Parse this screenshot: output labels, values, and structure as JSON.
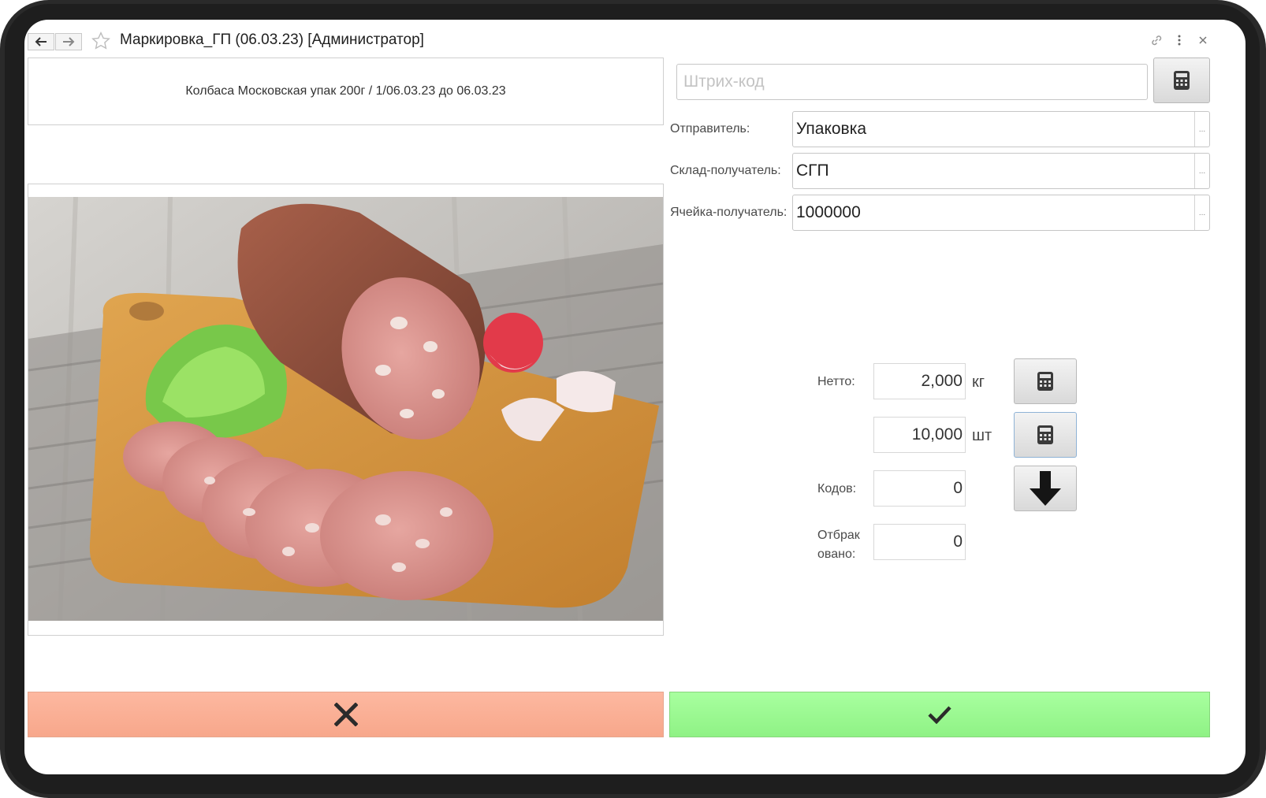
{
  "window": {
    "title": "Маркировка_ГП (06.03.23) [Администратор]"
  },
  "product": {
    "description": "Колбаса Московская упак 200г / 1/06.03.23 до 06.03.23"
  },
  "barcode": {
    "placeholder": "Штрих-код",
    "value": ""
  },
  "form": {
    "sender_label": "Отправитель:",
    "sender_value": "Упаковка",
    "warehouse_label": "Склад-получатель:",
    "warehouse_value": "СГП",
    "cell_label": "Ячейка-получатель:",
    "cell_value": "1000000",
    "select_dots": "..."
  },
  "metrics": {
    "netto_label": "Нетто:",
    "netto_value": "2,000",
    "netto_unit": "кг",
    "pieces_value": "10,000",
    "pieces_unit": "шт",
    "codes_label": "Кодов:",
    "codes_value": "0",
    "rejected_label_line1": "Отбрак",
    "rejected_label_line2": "овано:",
    "rejected_value": "0"
  },
  "icons": {
    "back": "arrow-left-icon",
    "forward": "arrow-right-icon",
    "favorite": "star-icon",
    "link": "link-icon",
    "menu": "more-vertical-icon",
    "close": "close-icon",
    "calculator": "calculator-icon",
    "download": "arrow-down-icon",
    "cancel": "cross-icon",
    "confirm": "check-icon"
  },
  "colors": {
    "cancel_bg": "#fdb8a0",
    "confirm_bg": "#a8ff9f"
  }
}
